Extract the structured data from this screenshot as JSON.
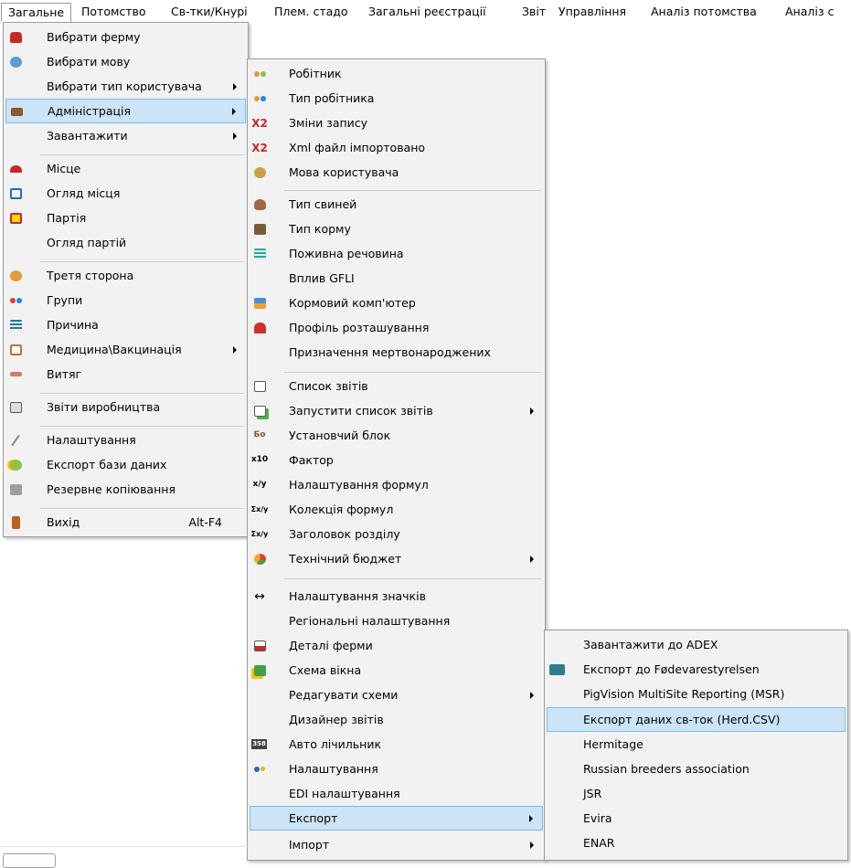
{
  "menubar": {
    "items": [
      {
        "label": "Загальне"
      },
      {
        "label": "Потомство"
      },
      {
        "label": "Св-тки/Кнурі"
      },
      {
        "label": "Плем. стадо"
      },
      {
        "label": "Загальні реєстрації"
      },
      {
        "label": "Звіт"
      },
      {
        "label": "Управління"
      },
      {
        "label": "Аналіз потомства"
      },
      {
        "label": "Аналіз с"
      }
    ]
  },
  "general_menu": {
    "items": [
      {
        "label": "Вибрати ферму",
        "icon": "farm-truck-icon"
      },
      {
        "label": "Вибрати мову",
        "icon": "language-globe-icon"
      },
      {
        "label": "Вибрати тип користувача",
        "icon": ""
      },
      {
        "label": "Адміністрація",
        "icon": "administration-desk-icon"
      },
      {
        "label": "Завантажити",
        "icon": ""
      },
      {
        "label": "Місце",
        "icon": "location-icon"
      },
      {
        "label": "Огляд місця",
        "icon": "location-overview-icon"
      },
      {
        "label": "Партія",
        "icon": "batch-icon"
      },
      {
        "label": "Огляд партій",
        "icon": ""
      },
      {
        "label": "Третя сторона",
        "icon": "third-party-icon"
      },
      {
        "label": "Групи",
        "icon": "groups-icon"
      },
      {
        "label": "Причина",
        "icon": "reason-list-icon"
      },
      {
        "label": "Медицина\\Вакцинація",
        "icon": "medicine-clipboard-icon"
      },
      {
        "label": "Витяг",
        "icon": "extract-icon"
      },
      {
        "label": "Звіти виробництва",
        "icon": "production-reports-icon"
      },
      {
        "label": "Налаштування",
        "icon": "settings-wrench-icon"
      },
      {
        "label": "Експорт бази даних",
        "icon": "database-export-icon"
      },
      {
        "label": "Резервне копіювання",
        "icon": "backup-icon"
      },
      {
        "label": "Вихід",
        "icon": "exit-door-icon",
        "shortcut": "Alt-F4"
      }
    ]
  },
  "admin_menu": {
    "items": [
      {
        "label": "Робітник",
        "icon": "worker-icon"
      },
      {
        "label": "Тип робітника",
        "icon": "worker-type-icon"
      },
      {
        "label": "Зміни запису",
        "icon": "record-changes-icon",
        "icon_text": "X2"
      },
      {
        "label": "Xml файл імпортовано",
        "icon": "xml-imported-icon",
        "icon_text": "X2"
      },
      {
        "label": "Мова користувача",
        "icon": "user-language-icon"
      },
      {
        "label": "Тип свиней",
        "icon": "pig-type-icon"
      },
      {
        "label": "Тип корму",
        "icon": "feed-type-icon"
      },
      {
        "label": "Поживна речовина",
        "icon": "nutrient-icon"
      },
      {
        "label": "Вплив GFLI",
        "icon": ""
      },
      {
        "label": "Кормовий комп'ютер",
        "icon": "feed-computer-icon"
      },
      {
        "label": "Профіль розташування",
        "icon": "location-profile-icon"
      },
      {
        "label": "Призначення мертвонароджених",
        "icon": ""
      },
      {
        "label": "Список звітів",
        "icon": "report-list-icon"
      },
      {
        "label": "Запустити список звітів",
        "icon": "run-report-list-icon"
      },
      {
        "label": "Установчий блок",
        "icon": "setup-block-icon",
        "icon_text": "Бо"
      },
      {
        "label": "Фактор",
        "icon": "factor-icon",
        "icon_text": "x10"
      },
      {
        "label": "Налаштування формул",
        "icon": "formula-settings-icon",
        "icon_text": "x/y"
      },
      {
        "label": "Колекція формул",
        "icon": "formula-collection-icon",
        "icon_text": "Σx/y"
      },
      {
        "label": "Заголовок розділу",
        "icon": "section-header-icon",
        "icon_text": "Σx/y"
      },
      {
        "label": "Технічний бюджет",
        "icon": "technical-budget-icon"
      },
      {
        "label": "Налаштування значків",
        "icon": "icon-settings-icon",
        "icon_text": "↔"
      },
      {
        "label": "Регіональні налаштування",
        "icon": ""
      },
      {
        "label": "Деталі ферми",
        "icon": "farm-details-icon"
      },
      {
        "label": "Схема вікна",
        "icon": "window-layout-icon"
      },
      {
        "label": "Редагувати схеми",
        "icon": ""
      },
      {
        "label": "Дизайнер звітів",
        "icon": ""
      },
      {
        "label": "Авто лічильник",
        "icon": "auto-counter-icon",
        "icon_text": "358"
      },
      {
        "label": "Налаштування",
        "icon": "settings-gears-icon"
      },
      {
        "label": "EDI налаштування",
        "icon": ""
      },
      {
        "label": "Експорт",
        "icon": ""
      },
      {
        "label": "Імпорт",
        "icon": ""
      }
    ]
  },
  "export_menu": {
    "items": [
      {
        "label": "Завантажити до ADEX",
        "icon": ""
      },
      {
        "label": "Експорт до Fødevarestyrelsen",
        "icon": "danish-crown-icon"
      },
      {
        "label": "PigVision MultiSite Reporting (MSR)",
        "icon": ""
      },
      {
        "label": "Експорт даних св-ток (Herd.CSV)",
        "icon": ""
      },
      {
        "label": "Hermitage",
        "icon": ""
      },
      {
        "label": "Russian breeders association",
        "icon": ""
      },
      {
        "label": "JSR",
        "icon": ""
      },
      {
        "label": "Evira",
        "icon": ""
      },
      {
        "label": "ENAR",
        "icon": ""
      }
    ]
  },
  "colors": {
    "menu_bg": "#f2f2f2",
    "highlight_bg": "#cce4f7",
    "highlight_border": "#7fbbe6"
  }
}
